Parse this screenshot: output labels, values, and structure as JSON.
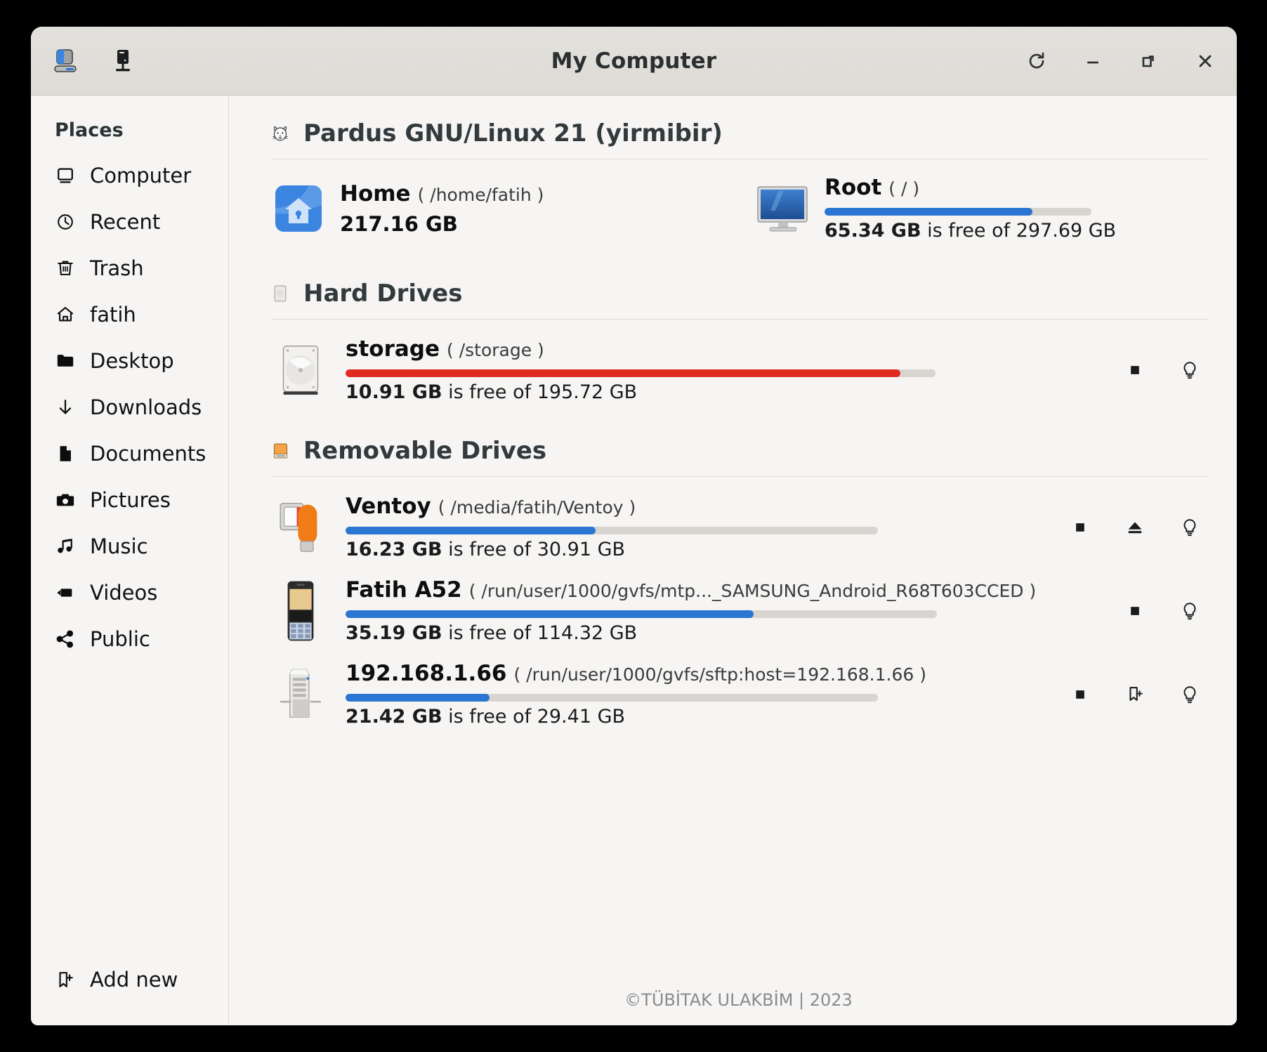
{
  "window": {
    "title": "My Computer",
    "titlebar_icons": [
      {
        "name": "my-computer-icon",
        "label": "My Computer"
      },
      {
        "name": "pc-tower-icon",
        "label": "Computer"
      }
    ],
    "controls": [
      {
        "name": "refresh-button",
        "glyph": "refresh",
        "label": "Refresh"
      },
      {
        "name": "minimize-button",
        "glyph": "minimize",
        "label": "Minimize"
      },
      {
        "name": "maximize-button",
        "glyph": "maximize",
        "label": "Maximize"
      },
      {
        "name": "close-button",
        "glyph": "close",
        "label": "Close"
      }
    ]
  },
  "sidebar": {
    "heading": "Places",
    "items": [
      {
        "label": "Computer",
        "icon": "monitor-icon"
      },
      {
        "label": "Recent",
        "icon": "clock-icon"
      },
      {
        "label": "Trash",
        "icon": "trash-icon"
      },
      {
        "label": "fatih",
        "icon": "home-icon"
      },
      {
        "label": "Desktop",
        "icon": "folder-icon"
      },
      {
        "label": "Downloads",
        "icon": "download-arrow-icon"
      },
      {
        "label": "Documents",
        "icon": "document-icon"
      },
      {
        "label": "Pictures",
        "icon": "camera-icon"
      },
      {
        "label": "Music",
        "icon": "music-note-icon"
      },
      {
        "label": "Videos",
        "icon": "video-camera-icon"
      },
      {
        "label": "Public",
        "icon": "share-icon"
      }
    ],
    "add_new": {
      "label": "Add new",
      "icon": "add-bookmark-icon"
    }
  },
  "main": {
    "distro": {
      "title": "Pardus GNU/Linux 21 (yirmibir)",
      "icon": "pardus-leopard-icon"
    },
    "home": {
      "name": "Home",
      "path": "( /home/fatih )",
      "size": "217.16 GB",
      "icon": "home-folder-icon"
    },
    "root": {
      "name": "Root",
      "path": "( / )",
      "free_label": "65.34 GB",
      "free_suffix": " is free of 297.69 GB",
      "percent_used": 78,
      "bar_color": "#2a76d2",
      "icon": "root-monitor-icon"
    },
    "sections": [
      {
        "id": "hard-drives",
        "title": "Hard Drives",
        "icon": "hard-disk-icon",
        "drives": [
          {
            "name": "storage",
            "path": "( /storage )",
            "free_label": "10.91 GB",
            "free_suffix": " is free of 195.72 GB",
            "percent_used": 94,
            "bar_color": "#e02b22",
            "icon": "hard-disk-platter-icon",
            "actions": [
              "stop-square-icon",
              "lightbulb-icon"
            ]
          }
        ]
      },
      {
        "id": "removable-drives",
        "title": "Removable Drives",
        "icon": "removable-drive-icon",
        "drives": [
          {
            "name": "Ventoy",
            "path": "( /media/fatih/Ventoy )",
            "free_label": "16.23 GB",
            "free_suffix": " is free of 30.91 GB",
            "percent_used": 47,
            "bar_color": "#2a76d2",
            "icon": "usb-flash-drive-icon",
            "actions": [
              "stop-square-icon",
              "eject-icon",
              "lightbulb-icon"
            ]
          },
          {
            "name": "Fatih A52",
            "path": "( /run/user/1000/gvfs/mtp..._SAMSUNG_Android_R68T603CCED )",
            "free_label": "35.19 GB",
            "free_suffix": " is free of 114.32 GB",
            "percent_used": 69,
            "bar_color": "#2a76d2",
            "icon": "mobile-phone-icon",
            "actions": [
              "stop-square-icon",
              "lightbulb-icon"
            ]
          },
          {
            "name": "192.168.1.66",
            "path": "( /run/user/1000/gvfs/sftp:host=192.168.1.66 )",
            "free_label": "21.42 GB",
            "free_suffix": " is free of 29.41 GB",
            "percent_used": 27,
            "bar_color": "#2a76d2",
            "icon": "network-server-icon",
            "actions": [
              "stop-square-icon",
              "add-bookmark-icon",
              "lightbulb-icon"
            ]
          }
        ]
      }
    ],
    "footer": "©TÜBİTAK ULAKBİM | 2023"
  },
  "colors": {
    "accent_blue": "#2a76d2",
    "warning_red": "#e02b22",
    "window_bg": "#f6f5f4",
    "titlebar_bg": "#dedbd6",
    "track": "#d8d4cf"
  }
}
